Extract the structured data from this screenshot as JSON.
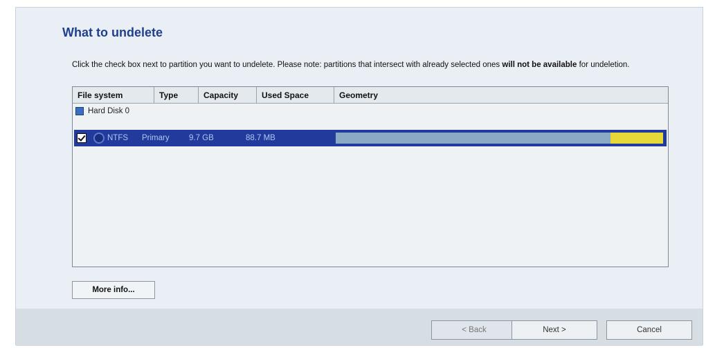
{
  "dialog": {
    "title": "What to undelete",
    "description_start": "Click the check box next to partition you want to undelete. Please note: partitions that intersect with already selected ones",
    "description_bold": "will not be available",
    "description_end": "for undeletion."
  },
  "table": {
    "columns": [
      "File system",
      "Type",
      "Capacity",
      "Used Space",
      "Geometry"
    ],
    "disk_label": "Hard Disk 0",
    "partition": {
      "checked": true,
      "file_system": "NTFS",
      "type": "Primary",
      "capacity": "9.7 GB",
      "used_space": "88.7 MB",
      "geometry_used_fraction": 0.16,
      "geometry_offset_fraction": 0.84
    }
  },
  "buttons": {
    "more_info": "More info...",
    "back": "< Back",
    "next": "Next >",
    "cancel": "Cancel"
  },
  "colors": {
    "selection": "#223a9c",
    "geometry_bar": "#8ba9c4",
    "geometry_fill": "#e7d83a"
  }
}
